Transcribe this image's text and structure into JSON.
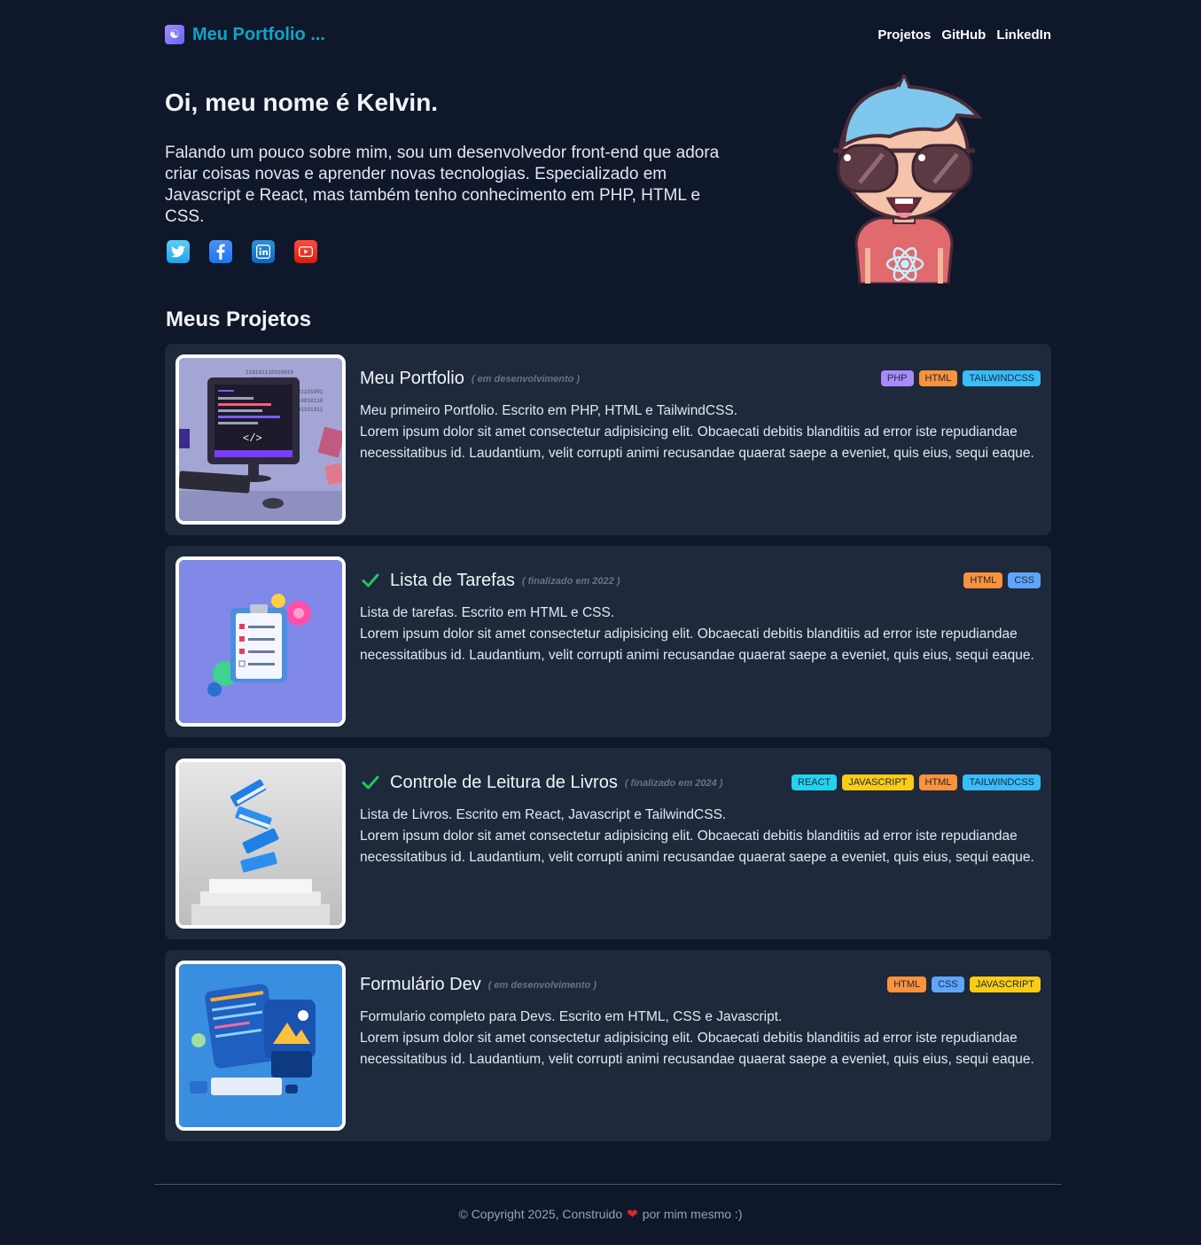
{
  "header": {
    "brand": "Meu Portfolio ...",
    "nav": [
      "Projetos",
      "GitHub",
      "LinkedIn"
    ]
  },
  "hero": {
    "title": "Oi, meu nome é Kelvin.",
    "text": "Falando um pouco sobre mim, sou um desenvolvedor front-end que adora criar coisas novas e aprender novas tecnologias. Especializado em Javascript e React, mas também tenho conhecimento em PHP, HTML e CSS.",
    "socials": [
      "twitter-icon",
      "facebook-icon",
      "linkedin-icon",
      "youtube-icon"
    ]
  },
  "projects": {
    "title": "Meus Projetos",
    "items": [
      {
        "title": "Meu Portfolio",
        "status": "( em desenvolvimento )",
        "done": false,
        "tags": [
          "PHP",
          "HTML",
          "TAILWINDCSS"
        ],
        "line1": "Meu primeiro Portfolio. Escrito em PHP, HTML e TailwindCSS.",
        "line2": "Lorem ipsum dolor sit amet consectetur adipisicing elit. Obcaecati debitis blanditiis ad error iste repudiandae necessitatibus id. Laudantium, velit corrupti animi recusandae quaerat saepe a eveniet, quis eius, sequi eaque."
      },
      {
        "title": "Lista de Tarefas",
        "status": "( finalizado em 2022 )",
        "done": true,
        "tags": [
          "HTML",
          "CSS"
        ],
        "line1": "Lista de tarefas. Escrito em HTML e CSS.",
        "line2": "Lorem ipsum dolor sit amet consectetur adipisicing elit. Obcaecati debitis blanditiis ad error iste repudiandae necessitatibus id. Laudantium, velit corrupti animi recusandae quaerat saepe a eveniet, quis eius, sequi eaque."
      },
      {
        "title": "Controle de Leitura de Livros",
        "status": "( finalizado em 2024 )",
        "done": true,
        "tags": [
          "REACT",
          "JAVASCRIPT",
          "HTML",
          "TAILWINDCSS"
        ],
        "line1": "Lista de Livros. Escrito em React, Javascript e TailwindCSS.",
        "line2": "Lorem ipsum dolor sit amet consectetur adipisicing elit. Obcaecati debitis blanditiis ad error iste repudiandae necessitatibus id. Laudantium, velit corrupti animi recusandae quaerat saepe a eveniet, quis eius, sequi eaque."
      },
      {
        "title": "Formulário Dev",
        "status": "( em desenvolvimento )",
        "done": false,
        "tags": [
          "HTML",
          "CSS",
          "JAVASCRIPT"
        ],
        "line1": "Formulario completo para Devs. Escrito em HTML, CSS e Javascript.",
        "line2": "Lorem ipsum dolor sit amet consectetur adipisicing elit. Obcaecati debitis blanditiis ad error iste repudiandae necessitatibus id. Laudantium, velit corrupti animi recusandae quaerat saepe a eveniet, quis eius, sequi eaque."
      }
    ]
  },
  "footer": {
    "before": "© Copyright 2025, Construido",
    "after": "por mim mesmo :)"
  },
  "colors": {
    "background": "#0f172a",
    "card": "#1e293b",
    "brand": "#0ea5c6",
    "check": "#22c55e"
  }
}
